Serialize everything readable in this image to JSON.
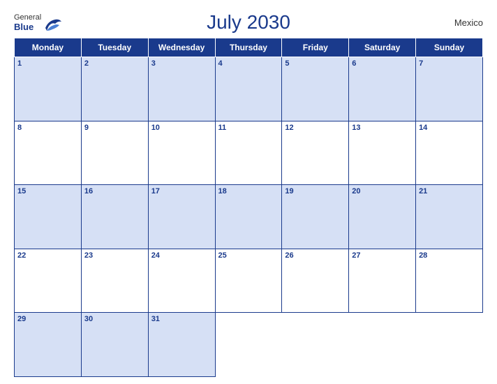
{
  "header": {
    "logo": {
      "general": "General",
      "blue": "Blue",
      "bird_alt": "GeneralBlue logo bird"
    },
    "title": "July 2030",
    "country": "Mexico"
  },
  "calendar": {
    "days_of_week": [
      "Monday",
      "Tuesday",
      "Wednesday",
      "Thursday",
      "Friday",
      "Saturday",
      "Sunday"
    ],
    "weeks": [
      [
        {
          "day": 1,
          "empty": false
        },
        {
          "day": 2,
          "empty": false
        },
        {
          "day": 3,
          "empty": false
        },
        {
          "day": 4,
          "empty": false
        },
        {
          "day": 5,
          "empty": false
        },
        {
          "day": 6,
          "empty": false
        },
        {
          "day": 7,
          "empty": false
        }
      ],
      [
        {
          "day": 8,
          "empty": false
        },
        {
          "day": 9,
          "empty": false
        },
        {
          "day": 10,
          "empty": false
        },
        {
          "day": 11,
          "empty": false
        },
        {
          "day": 12,
          "empty": false
        },
        {
          "day": 13,
          "empty": false
        },
        {
          "day": 14,
          "empty": false
        }
      ],
      [
        {
          "day": 15,
          "empty": false
        },
        {
          "day": 16,
          "empty": false
        },
        {
          "day": 17,
          "empty": false
        },
        {
          "day": 18,
          "empty": false
        },
        {
          "day": 19,
          "empty": false
        },
        {
          "day": 20,
          "empty": false
        },
        {
          "day": 21,
          "empty": false
        }
      ],
      [
        {
          "day": 22,
          "empty": false
        },
        {
          "day": 23,
          "empty": false
        },
        {
          "day": 24,
          "empty": false
        },
        {
          "day": 25,
          "empty": false
        },
        {
          "day": 26,
          "empty": false
        },
        {
          "day": 27,
          "empty": false
        },
        {
          "day": 28,
          "empty": false
        }
      ],
      [
        {
          "day": 29,
          "empty": false
        },
        {
          "day": 30,
          "empty": false
        },
        {
          "day": 31,
          "empty": false
        },
        {
          "day": null,
          "empty": true
        },
        {
          "day": null,
          "empty": true
        },
        {
          "day": null,
          "empty": true
        },
        {
          "day": null,
          "empty": true
        }
      ]
    ]
  }
}
